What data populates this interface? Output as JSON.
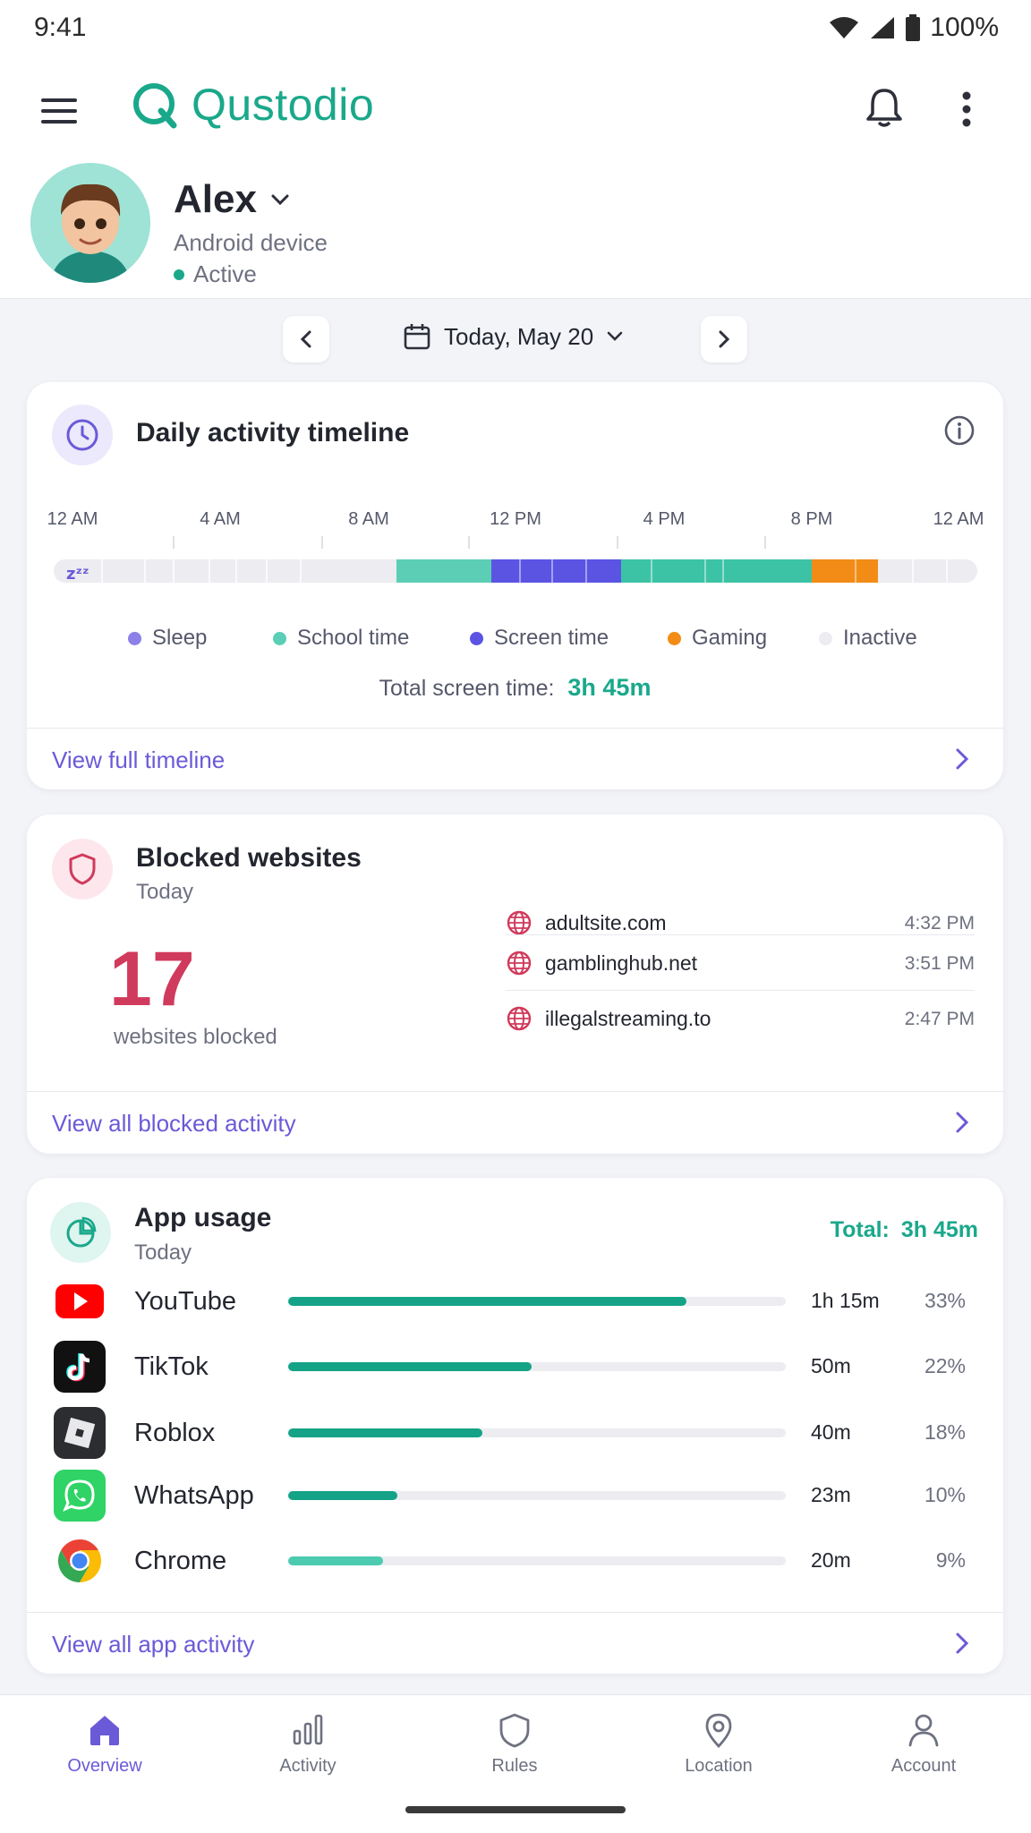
{
  "status_bar": {
    "time": "9:41",
    "battery": "100%"
  },
  "app": {
    "name": "Qustodio"
  },
  "child": {
    "name": "Alex",
    "device": "Android device",
    "status": "Active"
  },
  "date_nav": {
    "label": "Today, May 20"
  },
  "timeline_card": {
    "title": "Daily activity timeline",
    "axis_labels": [
      "12 AM",
      "4 AM",
      "8 AM",
      "12 PM",
      "4 PM",
      "8 PM",
      "12 AM"
    ],
    "legend": [
      {
        "label": "Sleep",
        "color": "#8d80e8"
      },
      {
        "label": "School time",
        "color": "#5cceb6"
      },
      {
        "label": "Screen time",
        "color": "#5b54e3"
      },
      {
        "label": "Gaming",
        "color": "#f28c17"
      },
      {
        "label": "Inactive",
        "color": "#ececf1"
      }
    ],
    "total_label": "Total screen time:",
    "total_value": "3h 45m",
    "link": "View full timeline"
  },
  "blocked_card": {
    "title": "Blocked websites",
    "subtitle": "Today",
    "count": "17",
    "count_label": "websites blocked",
    "sites": [
      {
        "domain": "adultsite.com",
        "time": "4:32 PM"
      },
      {
        "domain": "gamblinghub.net",
        "time": "3:51 PM"
      },
      {
        "domain": "illegalstreaming.to",
        "time": "2:47 PM"
      }
    ],
    "link": "View all blocked activity"
  },
  "apps_card": {
    "title": "App usage",
    "subtitle": "Today",
    "total_label": "Total:",
    "total_value": "3h 45m",
    "apps": [
      {
        "name": "YouTube",
        "duration": "1h 15m",
        "percent": "33%",
        "fill": 0.8,
        "icon": "youtube-icon"
      },
      {
        "name": "TikTok",
        "duration": "50m",
        "percent": "22%",
        "fill": 0.49,
        "icon": "tiktok-icon"
      },
      {
        "name": "Roblox",
        "duration": "40m",
        "percent": "18%",
        "fill": 0.39,
        "icon": "roblox-icon"
      },
      {
        "name": "WhatsApp",
        "duration": "23m",
        "percent": "10%",
        "fill": 0.22,
        "icon": "whatsapp-icon"
      },
      {
        "name": "Chrome",
        "duration": "20m",
        "percent": "9%",
        "fill": 0.19,
        "icon": "chrome-icon"
      }
    ],
    "link": "View all app activity"
  },
  "bottom_nav": {
    "items": [
      {
        "label": "Overview",
        "icon": "home-icon",
        "active": true
      },
      {
        "label": "Activity",
        "icon": "bar-chart-icon",
        "active": false
      },
      {
        "label": "Rules",
        "icon": "shield-icon",
        "active": false
      },
      {
        "label": "Location",
        "icon": "location-pin-icon",
        "active": false
      },
      {
        "label": "Account",
        "icon": "person-icon",
        "active": false
      }
    ]
  },
  "colors": {
    "brand": "#1aa88b",
    "accent": "#6a5ad8",
    "blocked": "#d03a5c"
  }
}
